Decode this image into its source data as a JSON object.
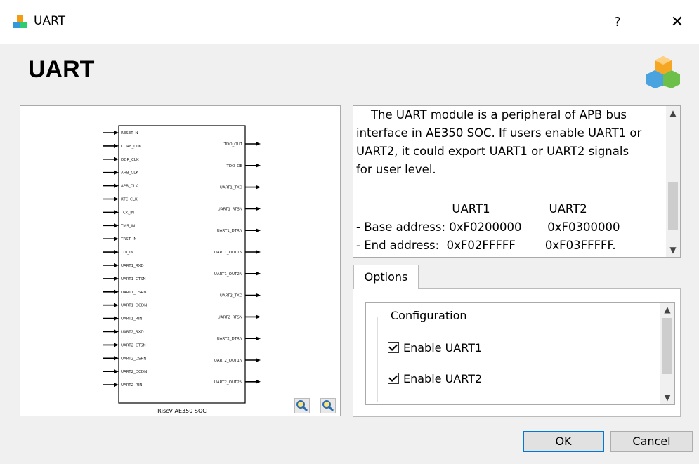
{
  "window": {
    "title": "UART",
    "help_label": "?",
    "close_label": "✕"
  },
  "header": {
    "title": "UART",
    "icon": "cubes-icon"
  },
  "diagram": {
    "block_label": "RiscV AE350 SOC",
    "inputs": [
      "RESET_N",
      "CORE_CLK",
      "DDR_CLK",
      "AHB_CLK",
      "APB_CLK",
      "RTC_CLK",
      "TCK_IN",
      "TMS_IN",
      "TRST_IN",
      "TDI_IN",
      "UART1_RXD",
      "UART1_CTSN",
      "UART1_DSRN",
      "UART1_DCDN",
      "UART1_RIN",
      "UART2_RXD",
      "UART2_CTSN",
      "UART2_DSRN",
      "UART2_DCDN",
      "UART2_RIN"
    ],
    "outputs": [
      "TDO_OUT",
      "TDO_OE",
      "UART1_TXD",
      "UART1_RTSN",
      "UART1_DTRN",
      "UART1_OUT1N",
      "UART1_OUT2N",
      "UART2_TXD",
      "UART2_RTSN",
      "UART2_DTRN",
      "UART2_OUT1N",
      "UART2_OUT2N"
    ],
    "zoom_in": "zoom-in-icon",
    "zoom_out": "zoom-out-icon"
  },
  "description": {
    "lines": [
      "    The UART module is a peripheral of APB bus",
      "interface in AE350 SOC. If users enable UART1 or",
      "UART2, it could export UART1 or UART2 signals",
      "for user level.",
      "",
      "                          UART1                UART2",
      "- Base address: 0xF0200000       0xF0300000",
      "- End address:  0xF02FFFFF        0xF03FFFFF."
    ]
  },
  "options": {
    "tab_label": "Options",
    "group_title": "Configuration",
    "checkboxes": [
      {
        "label": "Enable UART1",
        "checked": true
      },
      {
        "label": "Enable UART2",
        "checked": true
      }
    ]
  },
  "buttons": {
    "ok": "OK",
    "cancel": "Cancel"
  },
  "colors": {
    "ok_border": "#0078d7"
  }
}
